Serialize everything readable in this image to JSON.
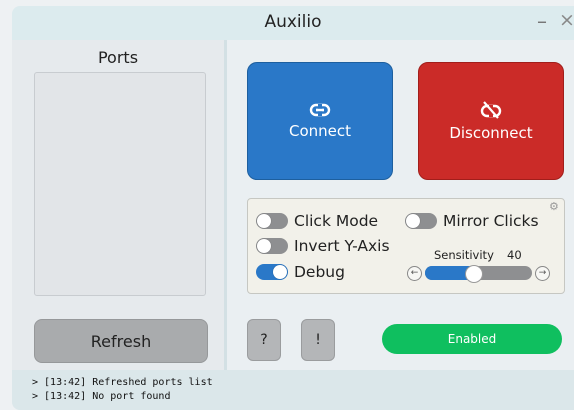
{
  "window": {
    "title": "Auxilio",
    "minimize_label": "–",
    "close_label": "×"
  },
  "ports": {
    "label": "Ports",
    "items": [],
    "refresh_label": "Refresh"
  },
  "actions": {
    "connect": {
      "label": "Connect",
      "icon": "link-icon",
      "color": "#2a78c8"
    },
    "disconnect": {
      "label": "Disconnect",
      "icon": "unlink-icon",
      "color": "#cb2b28"
    }
  },
  "settings": {
    "gear_icon": "⚙",
    "click_mode": {
      "label": "Click Mode",
      "enabled": false
    },
    "mirror_clicks": {
      "label": "Mirror Clicks",
      "enabled": false
    },
    "invert_y": {
      "label": "Invert Y-Axis",
      "enabled": false
    },
    "debug": {
      "label": "Debug",
      "enabled": true
    },
    "sensitivity": {
      "label": "Sensitivity",
      "value": "40",
      "level": 0.45,
      "dec_label": "←",
      "inc_label": "→"
    }
  },
  "bottom": {
    "help_label": "?",
    "alert_label": "!",
    "status_label": "Enabled",
    "status_color": "#0fbf5f"
  },
  "log": [
    "> [13:42] Refreshed ports list",
    "> [13:42] No port found"
  ]
}
